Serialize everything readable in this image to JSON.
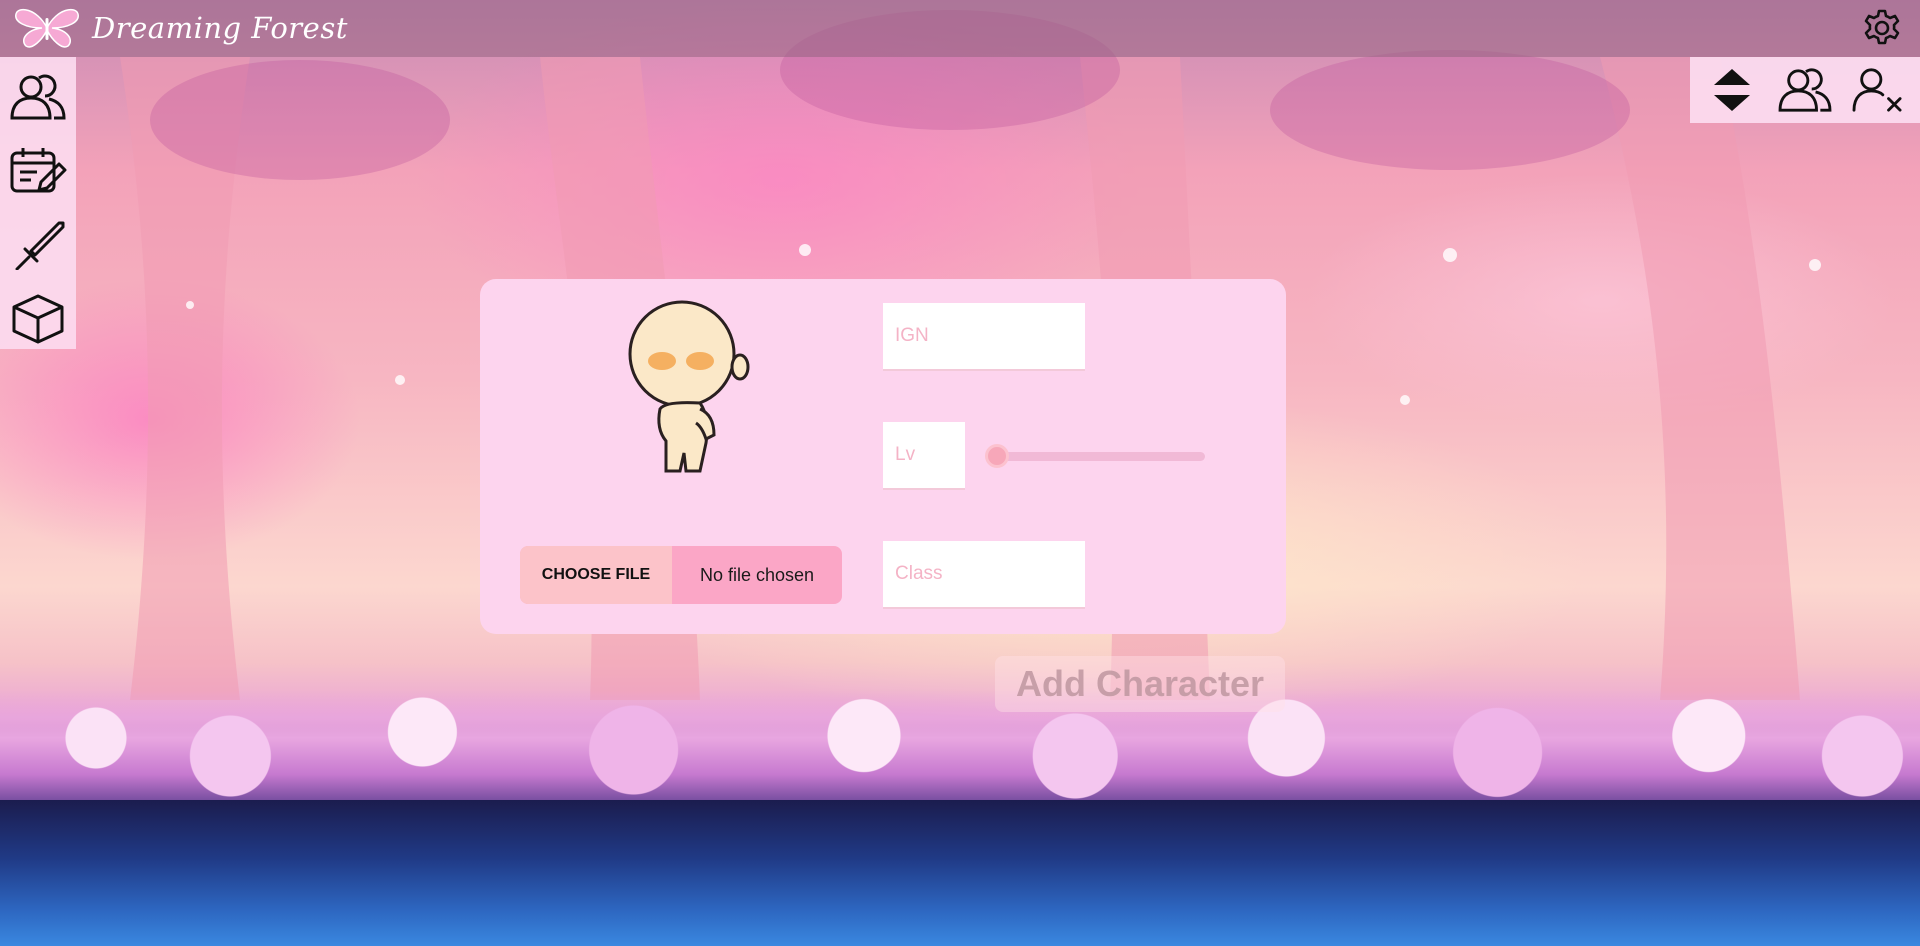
{
  "header": {
    "title": "Dreaming Forest",
    "logo_icon": "butterfly-icon",
    "settings_icon": "gear-icon"
  },
  "sidebar": {
    "items": [
      {
        "icon": "users-icon"
      },
      {
        "icon": "calendar-edit-icon"
      },
      {
        "icon": "sword-icon"
      },
      {
        "icon": "cube-icon"
      }
    ]
  },
  "toolbox": {
    "items": [
      {
        "icon": "sort-up-down-icon"
      },
      {
        "icon": "users-icon"
      },
      {
        "icon": "user-remove-icon"
      }
    ]
  },
  "form": {
    "ign_placeholder": "IGN",
    "lv_placeholder": "Lv",
    "class_placeholder": "Class",
    "level_slider_value": 0,
    "file_button_label": "CHOOSE FILE",
    "file_status": "No file chosen",
    "submit_label": "Add Character"
  },
  "colors": {
    "card_bg": "#fdd4ee",
    "panel_bg": "#fcdcf0",
    "accent": "#fba6c6",
    "placeholder": "#f4b3c6"
  }
}
